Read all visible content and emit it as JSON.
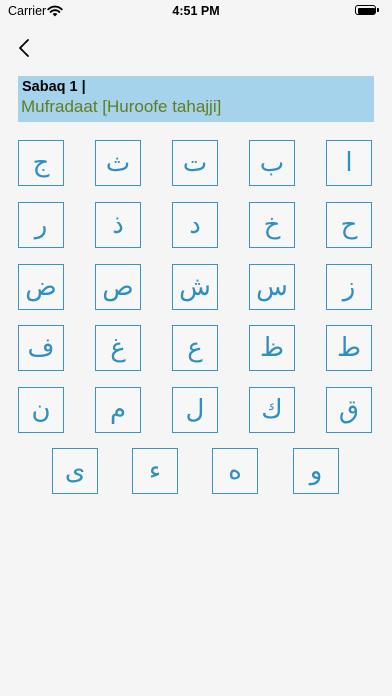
{
  "status_bar": {
    "carrier": "Carrier",
    "time": "4:51 PM"
  },
  "header": {
    "title": "Sabaq 1 |",
    "subtitle": "Mufradaat [Huroofe tahajji]"
  },
  "colors": {
    "accent": "#2f8fc0",
    "header_background": "#a6d3ec",
    "subtitle_text": "#5f7e1e"
  },
  "letters": {
    "row1": [
      "ا",
      "ب",
      "ت",
      "ث",
      "ج"
    ],
    "row2": [
      "ح",
      "خ",
      "د",
      "ذ",
      "ر"
    ],
    "row3": [
      "ز",
      "س",
      "ش",
      "ص",
      "ض"
    ],
    "row4": [
      "ط",
      "ظ",
      "ع",
      "غ",
      "ف"
    ],
    "row5": [
      "ق",
      "ك",
      "ل",
      "م",
      "ن"
    ],
    "row6": [
      "و",
      "ه",
      "ء",
      "ی"
    ]
  }
}
